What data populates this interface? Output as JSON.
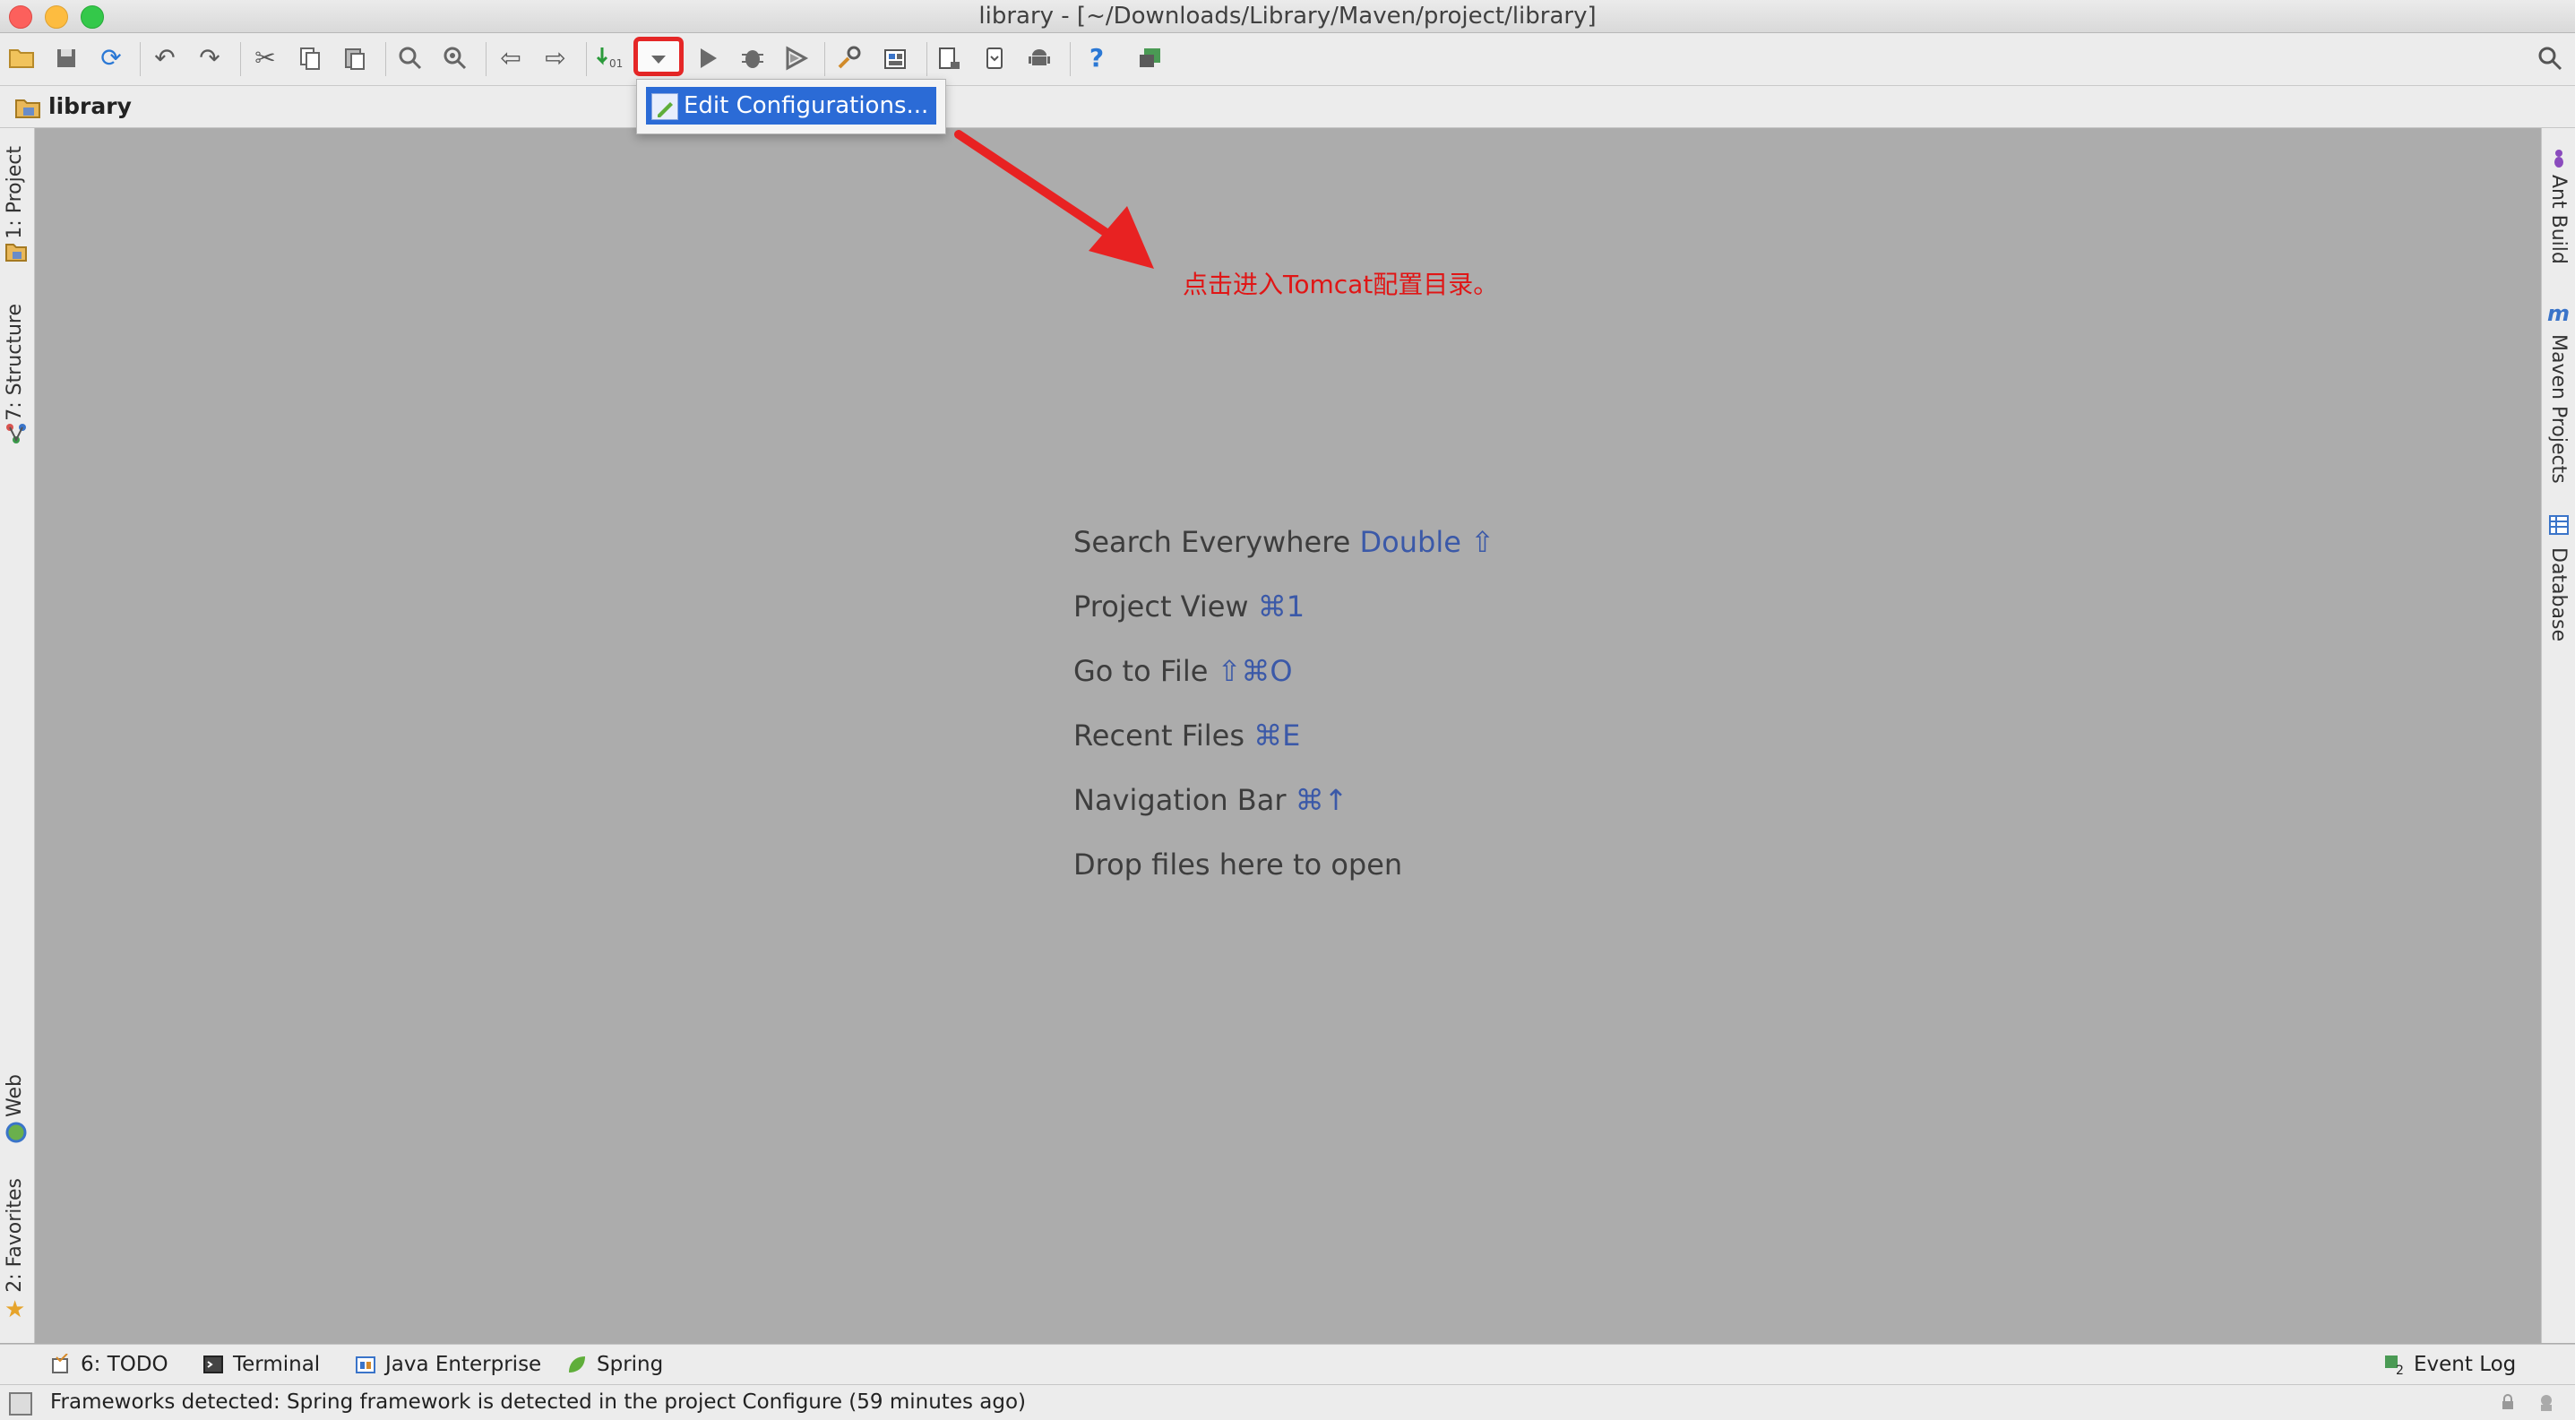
{
  "window": {
    "title": "library - [~/Downloads/Library/Maven/project/library]"
  },
  "navbar": {
    "crumb": "library"
  },
  "popup": {
    "item_label": "Edit Configurations..."
  },
  "annotation": {
    "text": "点击进入Tomcat配置目录。",
    "color": "#e01616"
  },
  "left_tool_windows": [
    "1: Project",
    "7: Structure",
    "Web",
    "2: Favorites"
  ],
  "right_tool_windows": [
    "Ant Build",
    "Maven Projects",
    "Database"
  ],
  "editor_hints": [
    {
      "label": "Search Everywhere",
      "shortcut": "Double ⇧"
    },
    {
      "label": "Project View",
      "shortcut": "⌘1"
    },
    {
      "label": "Go to File",
      "shortcut": "⇧⌘O"
    },
    {
      "label": "Recent Files",
      "shortcut": "⌘E"
    },
    {
      "label": "Navigation Bar",
      "shortcut": "⌘↑"
    },
    {
      "label": "Drop files here to open",
      "shortcut": ""
    }
  ],
  "bottom_tabs": {
    "todo": "6: TODO",
    "terminal": "Terminal",
    "java_ee": "Java Enterprise",
    "spring": "Spring",
    "event_log": "Event Log",
    "event_log_count": "2"
  },
  "status": {
    "message": "Frameworks detected: Spring framework is detected in the project Configure (59 minutes ago)"
  },
  "colors": {
    "accent": "#2b6bd6",
    "highlight_box": "#e52727",
    "shortcut": "#3b59a8"
  }
}
